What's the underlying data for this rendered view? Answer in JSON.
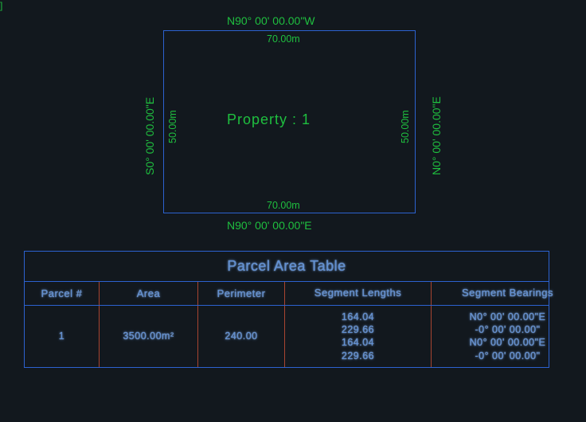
{
  "bracket": "]",
  "drawing": {
    "top_bearing": "N90° 00' 00.00\"W",
    "top_dim": "70.00m",
    "bottom_dim": "70.00m",
    "bottom_bearing": "N90° 00' 00.00\"E",
    "left_bearing": "S0° 00' 00.00\"E",
    "left_dim": "50.00m",
    "right_bearing": "N0° 00' 00.00\"E",
    "right_dim": "50.00m",
    "center_label": "Property : 1"
  },
  "table": {
    "title": "Parcel Area Table",
    "headers": {
      "c1": "Parcel #",
      "c2": "Area",
      "c3": "Perimeter",
      "c4": "Segment Lengths",
      "c5": "Segment Bearings"
    },
    "row": {
      "parcel": "1",
      "area": "3500.00m²",
      "perimeter": "240.00",
      "seg_lengths": [
        "164.04",
        "229.66",
        "164.04",
        "229.66"
      ],
      "seg_bearings": [
        "N0° 00' 00.00\"E",
        "-0° 00' 00.00\"",
        "N0° 00' 00.00\"E",
        "-0° 00' 00.00\""
      ]
    }
  }
}
